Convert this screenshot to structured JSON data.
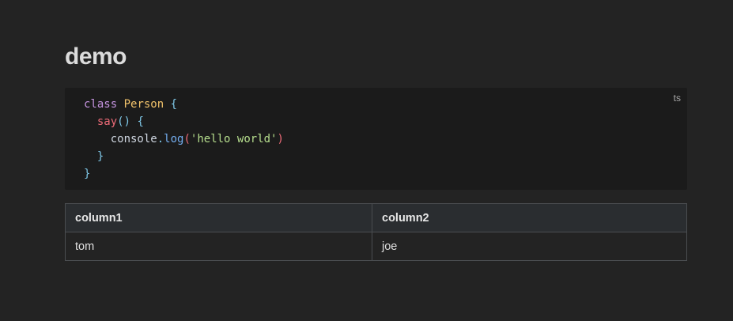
{
  "page": {
    "title": "demo"
  },
  "code_block": {
    "language": "ts",
    "lines": [
      [
        {
          "text": "class",
          "kind": "keyword"
        },
        {
          "text": " ",
          "kind": "plain"
        },
        {
          "text": "Person",
          "kind": "class"
        },
        {
          "text": " ",
          "kind": "plain"
        },
        {
          "text": "{",
          "kind": "punct"
        }
      ],
      [
        {
          "text": "  ",
          "kind": "plain"
        },
        {
          "text": "say",
          "kind": "func"
        },
        {
          "text": "()",
          "kind": "punct"
        },
        {
          "text": " ",
          "kind": "plain"
        },
        {
          "text": "{",
          "kind": "punct"
        }
      ],
      [
        {
          "text": "    ",
          "kind": "plain"
        },
        {
          "text": "console",
          "kind": "obj"
        },
        {
          "text": ".",
          "kind": "punct"
        },
        {
          "text": "log",
          "kind": "method"
        },
        {
          "text": "(",
          "kind": "paren-red"
        },
        {
          "text": "'hello world'",
          "kind": "string"
        },
        {
          "text": ")",
          "kind": "paren-red"
        }
      ],
      [
        {
          "text": "  ",
          "kind": "plain"
        },
        {
          "text": "}",
          "kind": "punct"
        }
      ],
      [
        {
          "text": "}",
          "kind": "punct"
        }
      ]
    ]
  },
  "table": {
    "headers": [
      "column1",
      "column2"
    ],
    "rows": [
      [
        "tom",
        "joe"
      ]
    ]
  },
  "colors": {
    "background": "#232323",
    "code_background": "#1b1b1b",
    "table_header_background": "#2a2d30",
    "table_border": "#4a4d50"
  }
}
